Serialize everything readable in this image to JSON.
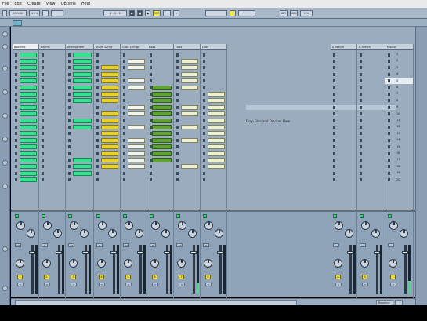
{
  "menu": [
    "File",
    "Edit",
    "Create",
    "View",
    "Options",
    "Help"
  ],
  "toolbar": {
    "tempo": "120.00",
    "sig": "4 / 4",
    "position": "1 . 1 . 1",
    "key_label": "KEY",
    "midi_label": "MIDI",
    "cpu": "9 %"
  },
  "tracks": [
    {
      "name": "Bassline",
      "active": true
    },
    {
      "name": "Drums",
      "active": false
    },
    {
      "name": "Atmosphere",
      "active": false
    },
    {
      "name": "Snare & Hat",
      "active": false
    },
    {
      "name": "Gate Strings",
      "active": false
    },
    {
      "name": "Bass",
      "active": false
    },
    {
      "name": "Lead",
      "active": false
    },
    {
      "name": "Lead",
      "active": false
    },
    {
      "name": "A Return",
      "active": false
    },
    {
      "name": "B Return",
      "active": false
    },
    {
      "name": "Master",
      "active": false
    }
  ],
  "drop_text": "Drop Files and Devices Here",
  "scenes": [
    "1",
    "2",
    "3",
    "4",
    "5",
    "6",
    "7",
    "8",
    "9",
    "10",
    "11",
    "12",
    "13",
    "14",
    "15",
    "16",
    "17",
    "18",
    "19",
    "20"
  ],
  "mixer": {
    "sends_label": "Sends",
    "knob_label": "Sends",
    "track_numbers": [
      "1",
      "2",
      "3",
      "4",
      "5",
      "6",
      "7",
      "8"
    ],
    "return_letters": [
      "A",
      "B"
    ],
    "values": [
      "-inf",
      "0",
      "-inf",
      "0",
      "-inf",
      "0",
      "-inf",
      "0"
    ],
    "solo_label": "S",
    "master_label": "Solo",
    "cue_label": "Cue"
  },
  "status": {
    "left": "",
    "right": "Bassline"
  },
  "colors": {
    "bg": "#8ea2b8",
    "green": "#39e08f",
    "yellow": "#e7cf2c",
    "cream": "#ecf0cf",
    "dark_green": "#60a236"
  }
}
